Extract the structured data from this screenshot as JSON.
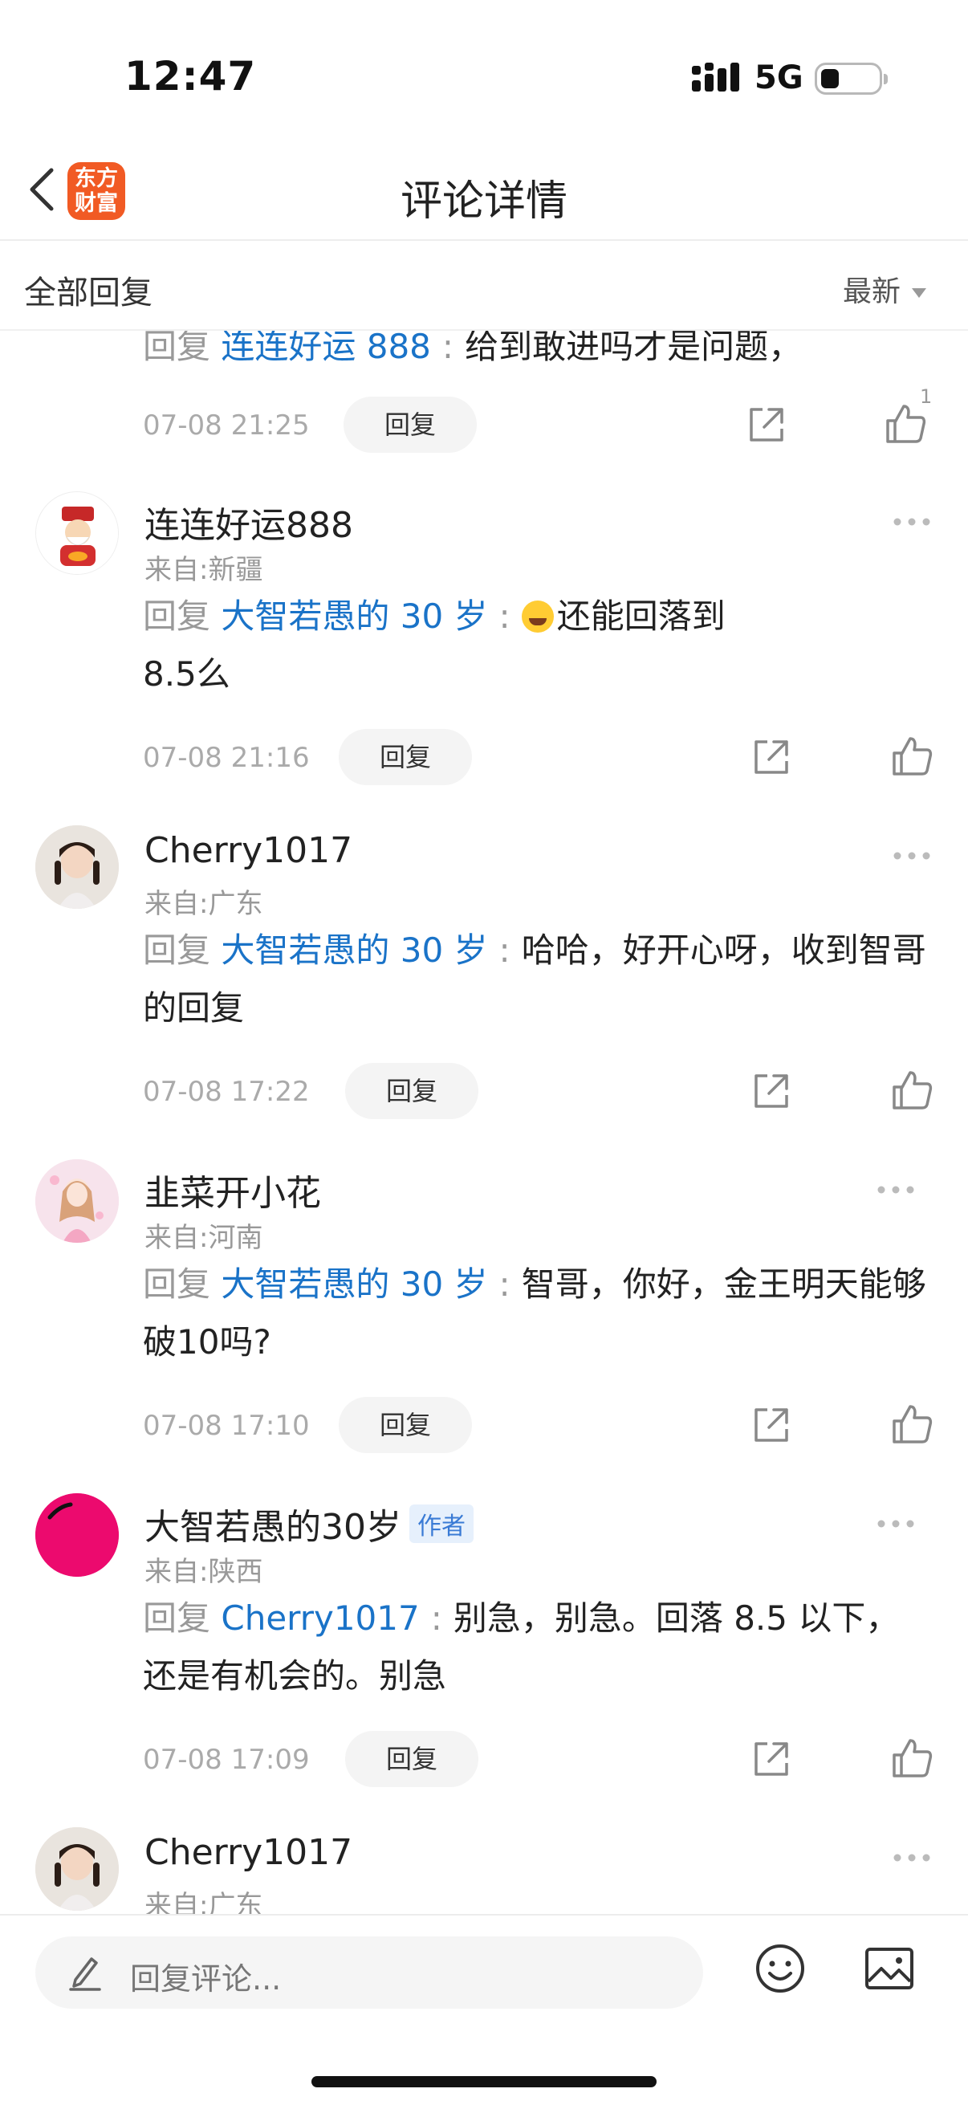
{
  "status_bar": {
    "time": "12:47",
    "network": "5G"
  },
  "nav": {
    "title": "评论详情",
    "logo_text": "东方财富"
  },
  "sub_header": {
    "all_replies": "全部回复",
    "sort": "最新"
  },
  "replies": [
    {
      "username": "",
      "location": "",
      "is_author": false,
      "reply_prefix": "回复",
      "mention": "连连好运 888",
      "text": "给到敢进吗才是问题，",
      "time": "07-08 21:25",
      "reply_button": "回复",
      "likes": "1"
    },
    {
      "username": "连连好运888",
      "location": "来自:新疆",
      "is_author": false,
      "reply_prefix": "回复",
      "mention": "大智若愚的 30 岁",
      "text": "还能回落到8.5么",
      "has_emoji": true,
      "time": "07-08 21:16",
      "reply_button": "回复",
      "likes": ""
    },
    {
      "username": "Cherry1017",
      "location": "来自:广东",
      "is_author": false,
      "reply_prefix": "回复",
      "mention": "大智若愚的 30 岁",
      "text": "哈哈，好开心呀，收到智哥的回复",
      "time": "07-08 17:22",
      "reply_button": "回复",
      "likes": ""
    },
    {
      "username": "韭菜开小花",
      "location": "来自:河南",
      "is_author": false,
      "reply_prefix": "回复",
      "mention": "大智若愚的 30 岁",
      "text": "智哥，你好，金王明天能够破10吗?",
      "time": "07-08 17:10",
      "reply_button": "回复",
      "likes": ""
    },
    {
      "username": "大智若愚的30岁",
      "location": "来自:陕西",
      "is_author": true,
      "author_badge": "作者",
      "reply_prefix": "回复",
      "mention": "Cherry1017",
      "text": "别急，别急。回落 8.5 以下，还是有机会的。别急",
      "time": "07-08 17:09",
      "reply_button": "回复",
      "likes": ""
    },
    {
      "username": "Cherry1017",
      "location": "来自:广东",
      "is_author": false
    }
  ],
  "bottom_bar": {
    "placeholder": "回复评论..."
  },
  "colors": {
    "accent_link": "#1a73c8",
    "logo_orange": "#f15a24",
    "author_avatar": "#ec0a6e"
  }
}
